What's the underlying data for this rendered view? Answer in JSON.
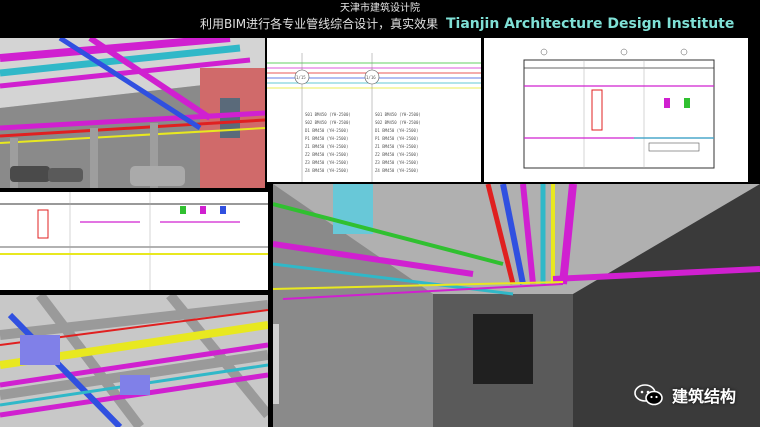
{
  "header": {
    "subtitle": "天津市建筑设计院",
    "title_cn": "利用BIM进行各专业管线综合设计，真实效果",
    "title_en": "Tianjin Architecture Design Institute"
  },
  "drawing_labels": {
    "axis_left": "1/15",
    "axis_right": "1/16",
    "rows": [
      "S01 BM450 (YH-2500)",
      "S02 BM450 (YH-2500)",
      "D1 BM450 (YH-2500)",
      "P1 BM450 (YH-2500)",
      "Z1 BM450 (YH-2500)",
      "Z2 BM450 (YH-2500)",
      "Z3 BM450 (YH-2500)",
      "Z4 BM450 (YH-2500)"
    ]
  },
  "watermark": {
    "icon": "wechat-icon",
    "label": "建筑结构"
  },
  "colors": {
    "pipe_magenta": "#d020d0",
    "pipe_cyan": "#30b8c8",
    "pipe_yellow": "#e8e820",
    "pipe_blue": "#3050e0",
    "pipe_red": "#e02020",
    "pipe_green": "#30c030"
  }
}
